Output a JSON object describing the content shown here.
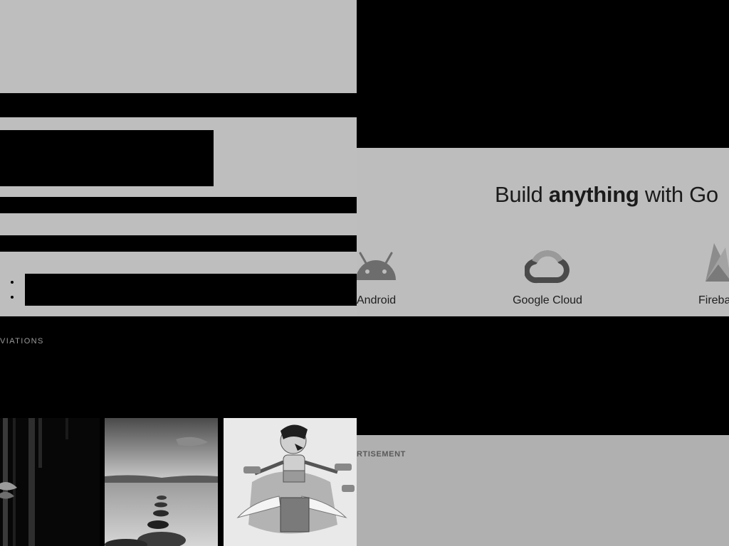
{
  "left_panel": {
    "bullets": [
      "",
      ""
    ],
    "section_label": "VIATIONS",
    "gallery": [
      {
        "icon": "forest-photo-thumbnail"
      },
      {
        "icon": "lake-stepping-stones-thumbnail"
      },
      {
        "icon": "winged-character-illustration-thumbnail"
      }
    ]
  },
  "right_panel": {
    "banner": {
      "headline_pre": "Build ",
      "headline_bold": "anything",
      "headline_post": " with Go",
      "products": [
        {
          "label": "Android",
          "icon": "android-icon"
        },
        {
          "label": "Google Cloud",
          "icon": "google-cloud-icon"
        },
        {
          "label": "Fireba",
          "icon": "firebase-icon"
        }
      ]
    },
    "ad_label": "RTISEMENT"
  },
  "colors": {
    "light_gray": "#bebebe",
    "banner_gray": "#bdbdbd",
    "ad_gray": "#b0b0b0",
    "redaction": "#000000"
  }
}
